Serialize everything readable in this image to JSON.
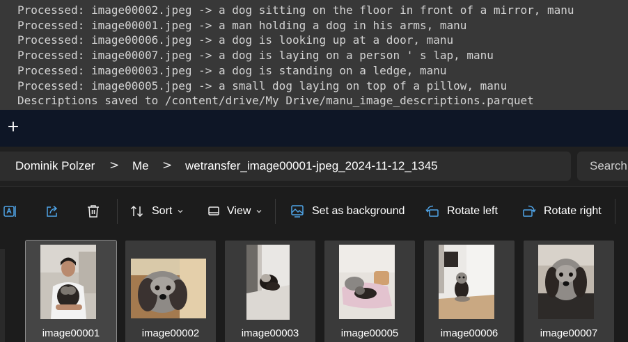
{
  "terminal": {
    "lines": [
      "Processed: image00002.jpeg -> a dog sitting on the floor in front of a mirror, manu",
      "Processed: image00001.jpeg -> a man holding a dog in his arms, manu",
      "Processed: image00006.jpeg -> a dog is looking up at a door, manu",
      "Processed: image00007.jpeg -> a dog is laying on a person ' s lap, manu",
      "Processed: image00003.jpeg -> a dog is standing on a ledge, manu",
      "Processed: image00005.jpeg -> a small dog laying on top of a pillow, manu",
      "Descriptions saved to /content/drive/My Drive/manu_image_descriptions.parquet"
    ]
  },
  "tabstrip": {
    "new_tab": "+"
  },
  "address": {
    "crumbs": [
      "Dominik Polzer",
      "Me",
      "wetransfer_image00001-jpeg_2024-11-12_1345"
    ],
    "separator": ">",
    "search_placeholder": "Search"
  },
  "toolbar": {
    "sort": "Sort",
    "view": "View",
    "set_background": "Set as background",
    "rotate_left": "Rotate left",
    "rotate_right": "Rotate right",
    "icons": {
      "ai": "ai-rewrite-icon",
      "share": "share-icon",
      "delete": "trash-icon",
      "sort": "sort-arrows-icon",
      "view": "view-icon",
      "background": "image-background-icon",
      "rotate_left": "rotate-left-icon",
      "rotate_right": "rotate-right-icon"
    }
  },
  "files": [
    {
      "name": "image00001",
      "selected": true
    },
    {
      "name": "image00002",
      "selected": false
    },
    {
      "name": "image00003",
      "selected": false
    },
    {
      "name": "image00005",
      "selected": false
    },
    {
      "name": "image00006",
      "selected": false
    },
    {
      "name": "image00007",
      "selected": false
    }
  ],
  "colors": {
    "terminal_bg": "#383838",
    "tabstrip_bg": "#0e1626",
    "explorer_bg": "#1c1c1c",
    "tile_bg": "#3a3a3a"
  }
}
